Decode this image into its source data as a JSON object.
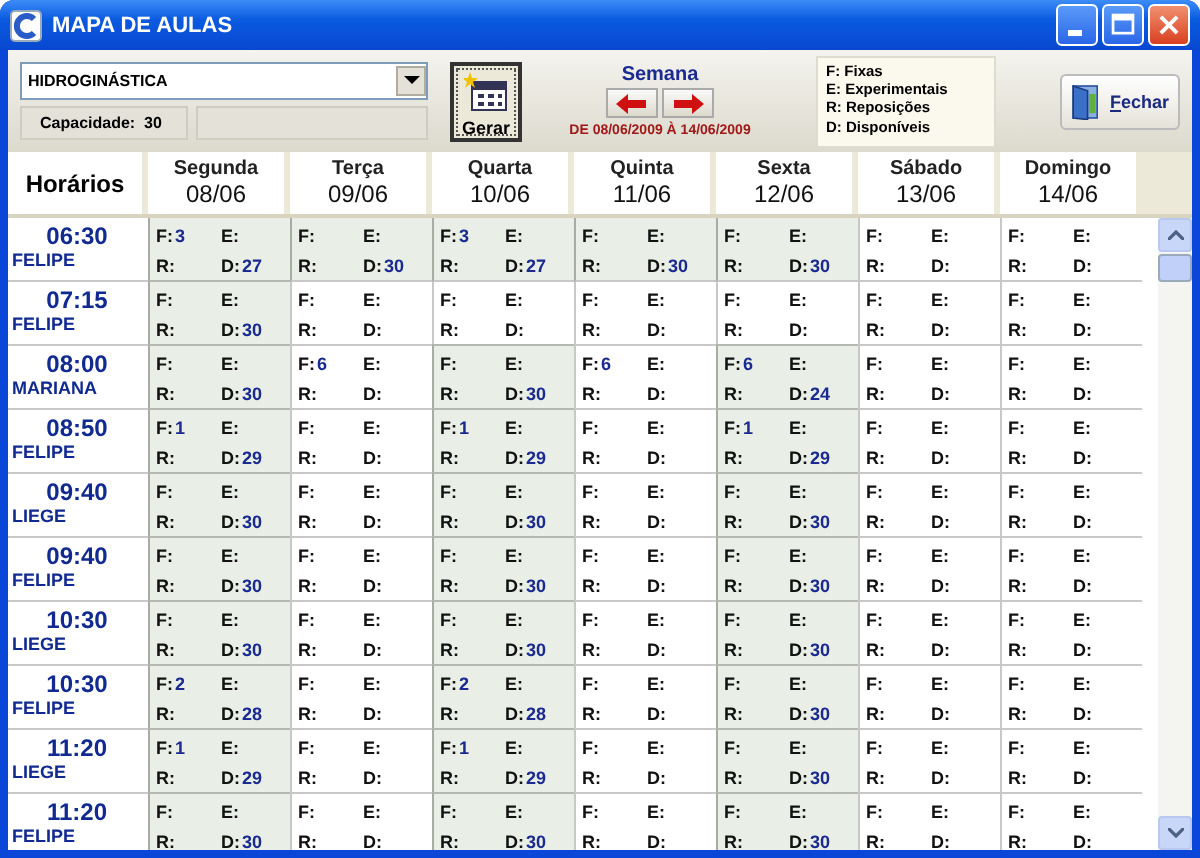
{
  "window": {
    "title": "MAPA DE AULAS"
  },
  "activity": {
    "value": "HIDROGINÁSTICA"
  },
  "capacity": "Capacidade:  30",
  "generate_button": "Gerar",
  "week": {
    "label": "Semana",
    "range": "DE 08/06/2009 À 14/06/2009"
  },
  "legend": [
    "F: Fixas",
    "E: Experimentais",
    "R: Reposições",
    "D: Disponíveis"
  ],
  "close_button": "Fechar",
  "header": {
    "label": "Horários"
  },
  "days": [
    {
      "name": "Segunda",
      "date": "08/06"
    },
    {
      "name": "Terça",
      "date": "09/06"
    },
    {
      "name": "Quarta",
      "date": "10/06"
    },
    {
      "name": "Quinta",
      "date": "11/06"
    },
    {
      "name": "Sexta",
      "date": "12/06"
    },
    {
      "name": "Sábado",
      "date": "13/06"
    },
    {
      "name": "Domingo",
      "date": "14/06"
    }
  ],
  "rows": [
    {
      "time": "06:30",
      "teacher": "FELIPE",
      "cells": [
        {
          "active": true,
          "items": [
            [
              "F:",
              "3"
            ],
            [
              "E:"
            ],
            [
              "R:"
            ],
            [
              "D:",
              "27"
            ]
          ]
        },
        {
          "active": true,
          "items": [
            [
              "F:"
            ],
            [
              "E:"
            ],
            [
              "R:"
            ],
            [
              "D:",
              "30"
            ]
          ]
        },
        {
          "active": true,
          "items": [
            [
              "F:",
              "3"
            ],
            [
              "E:"
            ],
            [
              "R:"
            ],
            [
              "D:",
              "27"
            ]
          ]
        },
        {
          "active": true,
          "items": [
            [
              "F:"
            ],
            [
              "E:"
            ],
            [
              "R:"
            ],
            [
              "D:",
              "30"
            ]
          ]
        },
        {
          "active": true,
          "items": [
            [
              "F:"
            ],
            [
              "E:"
            ],
            [
              "R:"
            ],
            [
              "D:",
              "30"
            ]
          ]
        },
        {
          "active": false,
          "items": [
            [
              "F:"
            ],
            [
              "E:"
            ],
            [
              "R:"
            ],
            [
              "D:"
            ]
          ]
        },
        {
          "active": false,
          "items": [
            [
              "F:"
            ],
            [
              "E:"
            ],
            [
              "R:"
            ],
            [
              "D:"
            ]
          ]
        }
      ]
    },
    {
      "time": "07:15",
      "teacher": "FELIPE",
      "cells": [
        {
          "active": true,
          "items": [
            [
              "F:"
            ],
            [
              "E:"
            ],
            [
              "R:"
            ],
            [
              "D:",
              "30"
            ]
          ]
        },
        {
          "active": false,
          "items": [
            [
              "F:"
            ],
            [
              "E:"
            ],
            [
              "R:"
            ],
            [
              "D:"
            ]
          ]
        },
        {
          "active": false,
          "items": [
            [
              "F:"
            ],
            [
              "E:"
            ],
            [
              "R:"
            ],
            [
              "D:"
            ]
          ]
        },
        {
          "active": false,
          "items": [
            [
              "F:"
            ],
            [
              "E:"
            ],
            [
              "R:"
            ],
            [
              "D:"
            ]
          ]
        },
        {
          "active": false,
          "items": [
            [
              "F:"
            ],
            [
              "E:"
            ],
            [
              "R:"
            ],
            [
              "D:"
            ]
          ]
        },
        {
          "active": false,
          "items": [
            [
              "F:"
            ],
            [
              "E:"
            ],
            [
              "R:"
            ],
            [
              "D:"
            ]
          ]
        },
        {
          "active": false,
          "items": [
            [
              "F:"
            ],
            [
              "E:"
            ],
            [
              "R:"
            ],
            [
              "D:"
            ]
          ]
        }
      ]
    },
    {
      "time": "08:00",
      "teacher": "MARIANA",
      "cells": [
        {
          "active": true,
          "items": [
            [
              "F:"
            ],
            [
              "E:"
            ],
            [
              "R:"
            ],
            [
              "D:",
              "30"
            ]
          ]
        },
        {
          "active": false,
          "items": [
            [
              "F:",
              "6"
            ],
            [
              "E:"
            ],
            [
              "R:"
            ],
            [
              "D:"
            ]
          ]
        },
        {
          "active": true,
          "items": [
            [
              "F:"
            ],
            [
              "E:"
            ],
            [
              "R:"
            ],
            [
              "D:",
              "30"
            ]
          ]
        },
        {
          "active": false,
          "items": [
            [
              "F:",
              "6"
            ],
            [
              "E:"
            ],
            [
              "R:"
            ],
            [
              "D:"
            ]
          ]
        },
        {
          "active": true,
          "items": [
            [
              "F:",
              "6"
            ],
            [
              "E:"
            ],
            [
              "R:"
            ],
            [
              "D:",
              "24"
            ]
          ]
        },
        {
          "active": false,
          "items": [
            [
              "F:"
            ],
            [
              "E:"
            ],
            [
              "R:"
            ],
            [
              "D:"
            ]
          ]
        },
        {
          "active": false,
          "items": [
            [
              "F:"
            ],
            [
              "E:"
            ],
            [
              "R:"
            ],
            [
              "D:"
            ]
          ]
        }
      ]
    },
    {
      "time": "08:50",
      "teacher": "FELIPE",
      "cells": [
        {
          "active": true,
          "items": [
            [
              "F:",
              "1"
            ],
            [
              "E:"
            ],
            [
              "R:"
            ],
            [
              "D:",
              "29"
            ]
          ]
        },
        {
          "active": false,
          "items": [
            [
              "F:"
            ],
            [
              "E:"
            ],
            [
              "R:"
            ],
            [
              "D:"
            ]
          ]
        },
        {
          "active": true,
          "items": [
            [
              "F:",
              "1"
            ],
            [
              "E:"
            ],
            [
              "R:"
            ],
            [
              "D:",
              "29"
            ]
          ]
        },
        {
          "active": false,
          "items": [
            [
              "F:"
            ],
            [
              "E:"
            ],
            [
              "R:"
            ],
            [
              "D:"
            ]
          ]
        },
        {
          "active": true,
          "items": [
            [
              "F:",
              "1"
            ],
            [
              "E:"
            ],
            [
              "R:"
            ],
            [
              "D:",
              "29"
            ]
          ]
        },
        {
          "active": false,
          "items": [
            [
              "F:"
            ],
            [
              "E:"
            ],
            [
              "R:"
            ],
            [
              "D:"
            ]
          ]
        },
        {
          "active": false,
          "items": [
            [
              "F:"
            ],
            [
              "E:"
            ],
            [
              "R:"
            ],
            [
              "D:"
            ]
          ]
        }
      ]
    },
    {
      "time": "09:40",
      "teacher": "LIEGE",
      "cells": [
        {
          "active": true,
          "items": [
            [
              "F:"
            ],
            [
              "E:"
            ],
            [
              "R:"
            ],
            [
              "D:",
              "30"
            ]
          ]
        },
        {
          "active": false,
          "items": [
            [
              "F:"
            ],
            [
              "E:"
            ],
            [
              "R:"
            ],
            [
              "D:"
            ]
          ]
        },
        {
          "active": true,
          "items": [
            [
              "F:"
            ],
            [
              "E:"
            ],
            [
              "R:"
            ],
            [
              "D:",
              "30"
            ]
          ]
        },
        {
          "active": false,
          "items": [
            [
              "F:"
            ],
            [
              "E:"
            ],
            [
              "R:"
            ],
            [
              "D:"
            ]
          ]
        },
        {
          "active": true,
          "items": [
            [
              "F:"
            ],
            [
              "E:"
            ],
            [
              "R:"
            ],
            [
              "D:",
              "30"
            ]
          ]
        },
        {
          "active": false,
          "items": [
            [
              "F:"
            ],
            [
              "E:"
            ],
            [
              "R:"
            ],
            [
              "D:"
            ]
          ]
        },
        {
          "active": false,
          "items": [
            [
              "F:"
            ],
            [
              "E:"
            ],
            [
              "R:"
            ],
            [
              "D:"
            ]
          ]
        }
      ]
    },
    {
      "time": "09:40",
      "teacher": "FELIPE",
      "cells": [
        {
          "active": true,
          "items": [
            [
              "F:"
            ],
            [
              "E:"
            ],
            [
              "R:"
            ],
            [
              "D:",
              "30"
            ]
          ]
        },
        {
          "active": false,
          "items": [
            [
              "F:"
            ],
            [
              "E:"
            ],
            [
              "R:"
            ],
            [
              "D:"
            ]
          ]
        },
        {
          "active": true,
          "items": [
            [
              "F:"
            ],
            [
              "E:"
            ],
            [
              "R:"
            ],
            [
              "D:",
              "30"
            ]
          ]
        },
        {
          "active": false,
          "items": [
            [
              "F:"
            ],
            [
              "E:"
            ],
            [
              "R:"
            ],
            [
              "D:"
            ]
          ]
        },
        {
          "active": true,
          "items": [
            [
              "F:"
            ],
            [
              "E:"
            ],
            [
              "R:"
            ],
            [
              "D:",
              "30"
            ]
          ]
        },
        {
          "active": false,
          "items": [
            [
              "F:"
            ],
            [
              "E:"
            ],
            [
              "R:"
            ],
            [
              "D:"
            ]
          ]
        },
        {
          "active": false,
          "items": [
            [
              "F:"
            ],
            [
              "E:"
            ],
            [
              "R:"
            ],
            [
              "D:"
            ]
          ]
        }
      ]
    },
    {
      "time": "10:30",
      "teacher": "LIEGE",
      "cells": [
        {
          "active": true,
          "items": [
            [
              "F:"
            ],
            [
              "E:"
            ],
            [
              "R:"
            ],
            [
              "D:",
              "30"
            ]
          ]
        },
        {
          "active": false,
          "items": [
            [
              "F:"
            ],
            [
              "E:"
            ],
            [
              "R:"
            ],
            [
              "D:"
            ]
          ]
        },
        {
          "active": true,
          "items": [
            [
              "F:"
            ],
            [
              "E:"
            ],
            [
              "R:"
            ],
            [
              "D:",
              "30"
            ]
          ]
        },
        {
          "active": false,
          "items": [
            [
              "F:"
            ],
            [
              "E:"
            ],
            [
              "R:"
            ],
            [
              "D:"
            ]
          ]
        },
        {
          "active": true,
          "items": [
            [
              "F:"
            ],
            [
              "E:"
            ],
            [
              "R:"
            ],
            [
              "D:",
              "30"
            ]
          ]
        },
        {
          "active": false,
          "items": [
            [
              "F:"
            ],
            [
              "E:"
            ],
            [
              "R:"
            ],
            [
              "D:"
            ]
          ]
        },
        {
          "active": false,
          "items": [
            [
              "F:"
            ],
            [
              "E:"
            ],
            [
              "R:"
            ],
            [
              "D:"
            ]
          ]
        }
      ]
    },
    {
      "time": "10:30",
      "teacher": "FELIPE",
      "cells": [
        {
          "active": true,
          "items": [
            [
              "F:",
              "2"
            ],
            [
              "E:"
            ],
            [
              "R:"
            ],
            [
              "D:",
              "28"
            ]
          ]
        },
        {
          "active": false,
          "items": [
            [
              "F:"
            ],
            [
              "E:"
            ],
            [
              "R:"
            ],
            [
              "D:"
            ]
          ]
        },
        {
          "active": true,
          "items": [
            [
              "F:",
              "2"
            ],
            [
              "E:"
            ],
            [
              "R:"
            ],
            [
              "D:",
              "28"
            ]
          ]
        },
        {
          "active": false,
          "items": [
            [
              "F:"
            ],
            [
              "E:"
            ],
            [
              "R:"
            ],
            [
              "D:"
            ]
          ]
        },
        {
          "active": true,
          "items": [
            [
              "F:"
            ],
            [
              "E:"
            ],
            [
              "R:"
            ],
            [
              "D:",
              "30"
            ]
          ]
        },
        {
          "active": false,
          "items": [
            [
              "F:"
            ],
            [
              "E:"
            ],
            [
              "R:"
            ],
            [
              "D:"
            ]
          ]
        },
        {
          "active": false,
          "items": [
            [
              "F:"
            ],
            [
              "E:"
            ],
            [
              "R:"
            ],
            [
              "D:"
            ]
          ]
        }
      ]
    },
    {
      "time": "11:20",
      "teacher": "LIEGE",
      "cells": [
        {
          "active": true,
          "items": [
            [
              "F:",
              "1"
            ],
            [
              "E:"
            ],
            [
              "R:"
            ],
            [
              "D:",
              "29"
            ]
          ]
        },
        {
          "active": false,
          "items": [
            [
              "F:"
            ],
            [
              "E:"
            ],
            [
              "R:"
            ],
            [
              "D:"
            ]
          ]
        },
        {
          "active": true,
          "items": [
            [
              "F:",
              "1"
            ],
            [
              "E:"
            ],
            [
              "R:"
            ],
            [
              "D:",
              "29"
            ]
          ]
        },
        {
          "active": false,
          "items": [
            [
              "F:"
            ],
            [
              "E:"
            ],
            [
              "R:"
            ],
            [
              "D:"
            ]
          ]
        },
        {
          "active": true,
          "items": [
            [
              "F:"
            ],
            [
              "E:"
            ],
            [
              "R:"
            ],
            [
              "D:",
              "30"
            ]
          ]
        },
        {
          "active": false,
          "items": [
            [
              "F:"
            ],
            [
              "E:"
            ],
            [
              "R:"
            ],
            [
              "D:"
            ]
          ]
        },
        {
          "active": false,
          "items": [
            [
              "F:"
            ],
            [
              "E:"
            ],
            [
              "R:"
            ],
            [
              "D:"
            ]
          ]
        }
      ]
    },
    {
      "time": "11:20",
      "teacher": "FELIPE",
      "cells": [
        {
          "active": true,
          "items": [
            [
              "F:"
            ],
            [
              "E:"
            ],
            [
              "R:"
            ],
            [
              "D:",
              "30"
            ]
          ]
        },
        {
          "active": false,
          "items": [
            [
              "F:"
            ],
            [
              "E:"
            ],
            [
              "R:"
            ],
            [
              "D:"
            ]
          ]
        },
        {
          "active": true,
          "items": [
            [
              "F:"
            ],
            [
              "E:"
            ],
            [
              "R:"
            ],
            [
              "D:",
              "30"
            ]
          ]
        },
        {
          "active": false,
          "items": [
            [
              "F:"
            ],
            [
              "E:"
            ],
            [
              "R:"
            ],
            [
              "D:"
            ]
          ]
        },
        {
          "active": true,
          "items": [
            [
              "F:"
            ],
            [
              "E:"
            ],
            [
              "R:"
            ],
            [
              "D:",
              "30"
            ]
          ]
        },
        {
          "active": false,
          "items": [
            [
              "F:"
            ],
            [
              "E:"
            ],
            [
              "R:"
            ],
            [
              "D:"
            ]
          ]
        },
        {
          "active": false,
          "items": [
            [
              "F:"
            ],
            [
              "E:"
            ],
            [
              "R:"
            ],
            [
              "D:"
            ]
          ]
        }
      ]
    }
  ]
}
